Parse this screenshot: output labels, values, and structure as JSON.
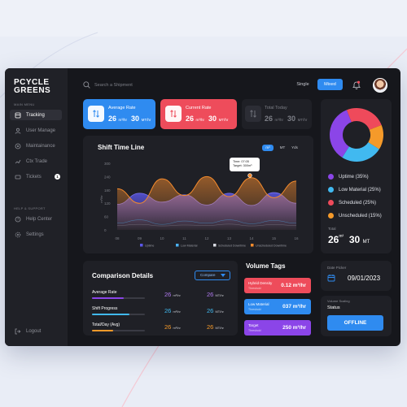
{
  "sidebar": {
    "logo_line1": "PCYCLE",
    "logo_line2": "GREENS",
    "main_menu_label": "MAIN MENU",
    "items": [
      {
        "label": "Tracking"
      },
      {
        "label": "User Manage"
      },
      {
        "label": "Maintainance"
      },
      {
        "label": "Ctx Trade"
      },
      {
        "label": "Tickets",
        "badge": "1"
      }
    ],
    "help_label": "HELP & SUPPORT",
    "help_items": [
      {
        "label": "Help Center"
      },
      {
        "label": "Settings"
      }
    ],
    "logout_label": "Logout"
  },
  "header": {
    "search_placeholder": "Search a Shipment",
    "toggle_single": "Single",
    "toggle_mixed": "Mixed"
  },
  "stats": [
    {
      "title": "Average Rate",
      "v1": "26",
      "u1": "m³/hr",
      "v2": "30",
      "u2": "MT/hr",
      "color": "#2f8bf0"
    },
    {
      "title": "Current Rate",
      "v1": "26",
      "u1": "m³/hr",
      "v2": "30",
      "u2": "MT/hr",
      "color": "#ee4c5b"
    },
    {
      "title": "Total Today",
      "v1": "26",
      "u1": "m³/hr",
      "v2": "30",
      "u2": "MT/hr",
      "color": "#1f2026"
    }
  ],
  "shift": {
    "title": "Shift Time Line",
    "units": [
      "m³",
      "MT",
      "Yds"
    ],
    "tooltip_time": "Time:    07:05",
    "tooltip_target": "Target:  300m³"
  },
  "chart_data": {
    "type": "area",
    "ylabel": "m³/hr",
    "yticks": [
      300,
      240,
      180,
      120,
      60,
      0
    ],
    "ylim": [
      0,
      300
    ],
    "x": [
      "08",
      "09",
      "10",
      "11",
      "12",
      "13",
      "14",
      "15",
      "16"
    ],
    "series": [
      {
        "name": "Uptime",
        "color": "#5b57e8",
        "values": [
          115,
          165,
          125,
          158,
          112,
          165,
          110,
          168,
          120
        ]
      },
      {
        "name": "Low Material",
        "color": "#4ab1f2",
        "values": [
          30,
          45,
          25,
          40,
          30,
          45,
          28,
          42,
          30
        ]
      },
      {
        "name": "Scheduled Downtime",
        "color": "#d9dbe2",
        "values": [
          20,
          25,
          18,
          22,
          20,
          26,
          18,
          24,
          20
        ]
      },
      {
        "name": "Unscheduled Downtime",
        "color": "#f58b2d",
        "values": [
          185,
          120,
          230,
          155,
          240,
          150,
          235,
          145,
          220
        ]
      }
    ]
  },
  "donut": {
    "items": [
      {
        "label": "Uptime (35%)",
        "color": "#8b45e8"
      },
      {
        "label": "Low Material (25%)",
        "color": "#41b9f0"
      },
      {
        "label": "Scheduled (25%)",
        "color": "#ef4a5b"
      },
      {
        "label": "Unscheduled (15%)",
        "color": "#f59a2a"
      }
    ],
    "total_label": "Total",
    "total_v1": "26",
    "total_u1": "m³",
    "total_v2": "30",
    "total_u2": "MT"
  },
  "comparison": {
    "title": "Comparison Details",
    "dropdown": "Compare",
    "rows": [
      {
        "label": "Average Rate",
        "v1": "26",
        "u1": "m³/hr",
        "v2": "26",
        "u2": "MT/hr",
        "color": "#8b45e8",
        "c1": "#b07af0",
        "fill": 0.6
      },
      {
        "label": "Shift Progress",
        "v1": "26",
        "u1": "m³/hr",
        "v2": "26",
        "u2": "MT/hr",
        "color": "#41b9f0",
        "c1": "#41b9f0",
        "fill": 0.7
      },
      {
        "label": "Total/Day (Avg)",
        "v1": "26",
        "u1": "m³/hr",
        "v2": "26",
        "u2": "MT/hr",
        "color": "#f59a2a",
        "c1": "#f59a2a",
        "fill": 0.4
      }
    ]
  },
  "volume": {
    "title": "Volume Tags",
    "tags": [
      {
        "label": "Hybrid Density",
        "sub": "Threshold",
        "value": "0.12 m³/hr",
        "color": "#ee4c5b"
      },
      {
        "label": "Low Material",
        "sub": "Threshold",
        "value": "037 m³/hr",
        "color": "#2f8bf0"
      },
      {
        "label": "Target",
        "sub": "Threshold",
        "value": "250 m³/hr",
        "color": "#8b45e8"
      }
    ]
  },
  "date": {
    "label": "Date Picker",
    "value": "09/01/2023"
  },
  "scaling": {
    "label": "Volume Scaling",
    "status_label": "Status",
    "button": "OFFLINE"
  }
}
